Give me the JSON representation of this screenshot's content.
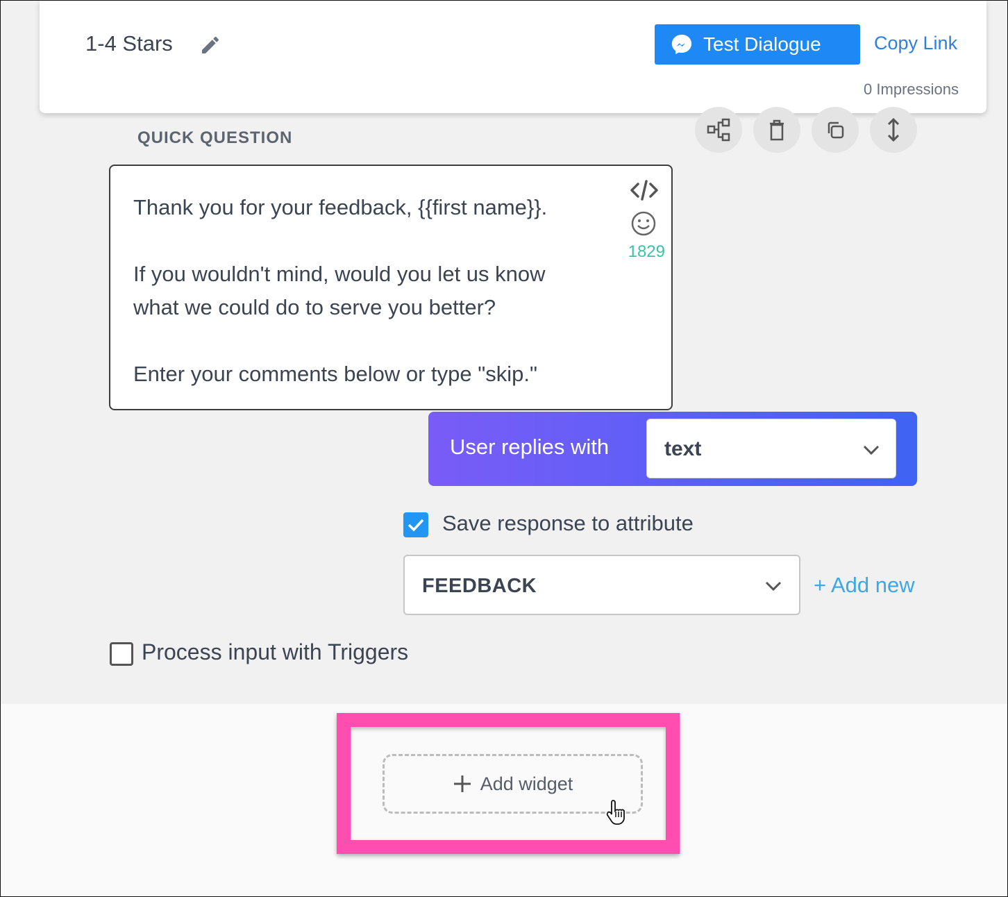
{
  "header": {
    "title": "1-4 Stars",
    "test_button": "Test Dialogue",
    "copy_link": "Copy Link",
    "impressions": "0 Impressions"
  },
  "section": {
    "label": "QUICK QUESTION",
    "tools": [
      "flow-icon",
      "trash-icon",
      "copy-icon",
      "resize-vertical-icon"
    ]
  },
  "message": {
    "lines": [
      "Thank you for your feedback, {{first name}}.",
      "",
      "If you wouldn't mind, would you let us know",
      "what we could do to serve you better?",
      "",
      "Enter your comments below or type \"skip.\""
    ],
    "char_count": "1829"
  },
  "reply": {
    "label": "User replies with",
    "selected": "text"
  },
  "save_response": {
    "label": "Save response to attribute",
    "checked": true,
    "attribute": "FEEDBACK",
    "add_new": "+ Add new"
  },
  "process_triggers": {
    "label": "Process input with Triggers",
    "checked": false
  },
  "add_widget": {
    "label": "Add widget"
  },
  "colors": {
    "accent_blue": "#1e88f5",
    "highlight_pink": "#ff4db0",
    "counter_green": "#3cc2a6",
    "gradient_start": "#7a5cf7",
    "gradient_end": "#3f63f3"
  }
}
